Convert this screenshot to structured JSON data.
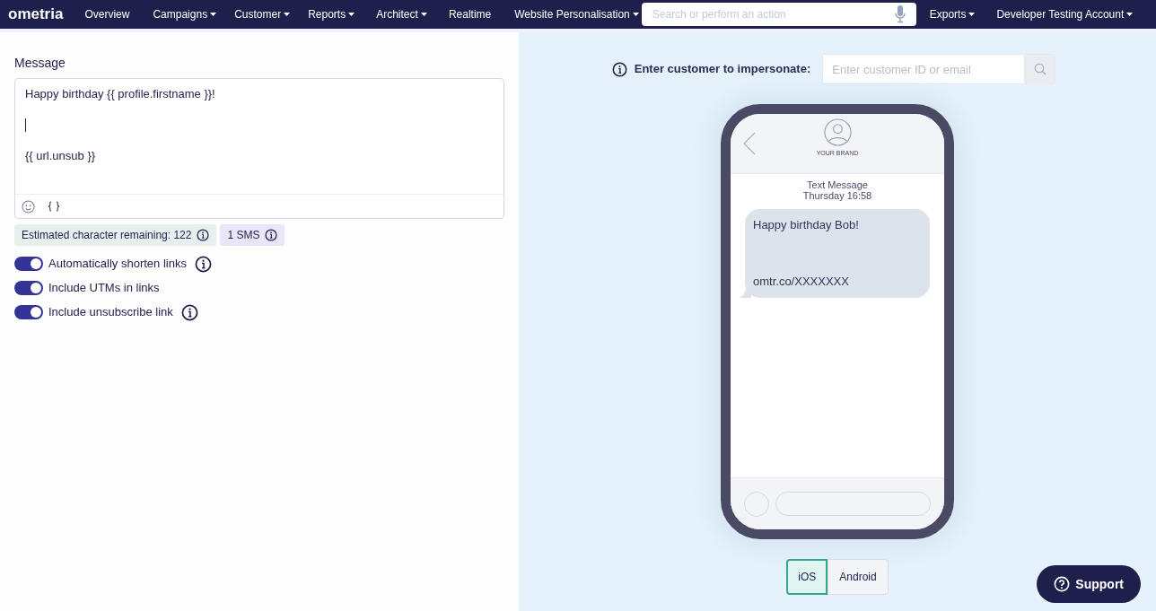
{
  "nav": {
    "logo": "ometria",
    "items": [
      {
        "label": "Overview",
        "dropdown": false
      },
      {
        "label": "Campaigns",
        "dropdown": true
      },
      {
        "label": "Customer",
        "dropdown": true
      },
      {
        "label": "Reports",
        "dropdown": true
      },
      {
        "label": "Architect",
        "dropdown": true
      },
      {
        "label": "Realtime",
        "dropdown": false
      },
      {
        "label": "Website Personalisation",
        "dropdown": true
      }
    ],
    "search": {
      "placeholder": "Search or perform an action"
    },
    "right_items": [
      {
        "label": "Exports",
        "dropdown": true
      },
      {
        "label": "Developer Testing Account",
        "dropdown": true
      }
    ]
  },
  "editor": {
    "label": "Message",
    "lines": [
      "Happy birthday {{ profile.firstname }}!",
      "{{ url.unsub }}"
    ],
    "badges": [
      {
        "text": "Estimated character remaining: 122",
        "color": "#e6f1ef"
      },
      {
        "text": "1 SMS",
        "color": "#e8e6f8"
      }
    ],
    "toggles": [
      {
        "label": "Automatically shorten links",
        "on": true,
        "info": true
      },
      {
        "label": "Include UTMs in links",
        "on": true,
        "info": false
      },
      {
        "label": "Include unsubscribe link",
        "on": true,
        "info": true
      }
    ]
  },
  "preview": {
    "impersonate_label": "Enter customer to impersonate:",
    "customer_field": {
      "placeholder": "Enter customer ID or email"
    },
    "phone": {
      "brand": "YOUR BRAND",
      "thread_title": "Text Message",
      "thread_time": "Thursday 16:58",
      "bubble_lines": [
        "Happy birthday Bob!",
        "omtr.co/XXXXXXX"
      ]
    },
    "platforms": [
      {
        "label": "iOS",
        "selected": true
      },
      {
        "label": "Android",
        "selected": false
      }
    ]
  },
  "support_button": "Support"
}
